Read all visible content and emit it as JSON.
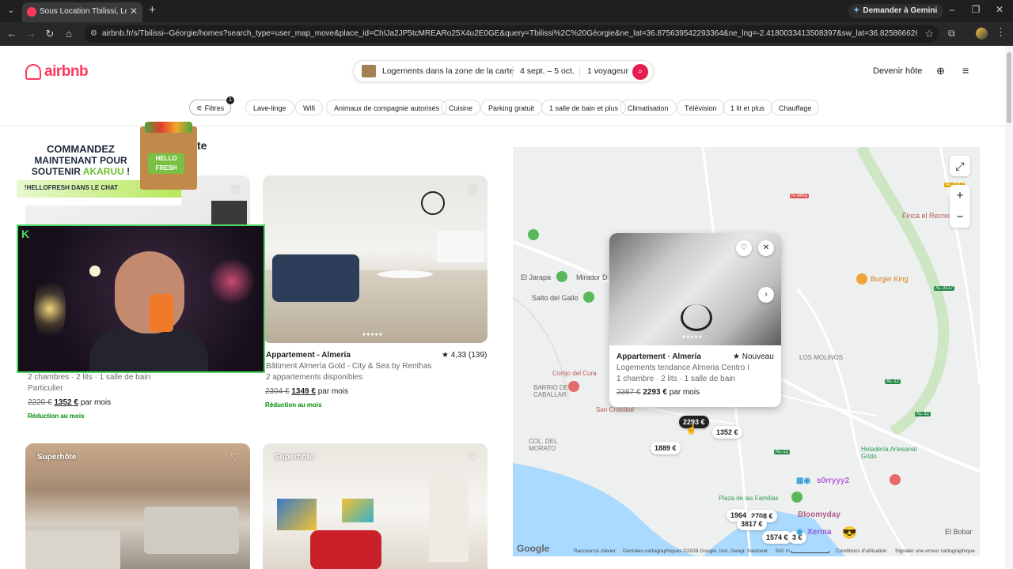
{
  "browser": {
    "tab_title": "Sous Location Tbilissi, Location",
    "gemini_label": "Demander à Gemini",
    "url": "airbnb.fr/s/Tbilissi--Géorgie/homes?search_type=user_map_move&place_id=ChIJa2JP5tcMREARo25X4u2E0GE&query=Tbilissi%2C%20Géorgie&ne_lat=36.875639542293364&ne_lng=-2.4180033413508397&sw_lat=36.82586662628848&sw_lng=-2..."
  },
  "header": {
    "logo": "airbnb",
    "search_location": "Logements dans la zone de la carte",
    "search_dates": "4 sept. – 5 oct.",
    "search_guests": "1 voyageur",
    "host_link": "Devenir hôte"
  },
  "filters": {
    "filter_label": "Filtres",
    "filter_count": "1",
    "chips": [
      "Lave-linge",
      "Wifi",
      "Animaux de compagnie autorisés",
      "Cuisine",
      "Parking gratuit",
      "1 salle de bain et plus",
      "Climatisation",
      "Télévision",
      "1 lit et plus",
      "Chauffage"
    ]
  },
  "listings": {
    "title_fragment": "carte",
    "card1": {
      "details": "2 chambres · 2 lits · 1 salle de bain",
      "host_type": "Particulier",
      "price_old": "2220 €",
      "price_new": "1352 €",
      "price_suffix": "par mois",
      "discount": "Réduction au mois"
    },
    "card2": {
      "title": "Appartement - Almería",
      "rating": "★ 4,33 (139)",
      "subtitle": "Bâtiment Almería Gold - City & Sea by Renthas",
      "availability": "2 appartements disponibles",
      "price_old": "2304 €",
      "price_new": "1349 €",
      "price_suffix": "par mois",
      "discount": "Réduction au mois"
    },
    "card3": {
      "badge": "Superhôte"
    },
    "card4": {
      "badge": "Superhôte"
    }
  },
  "promo": {
    "line1": "COMMANDEZ",
    "line2": "MAINTENANT POUR",
    "line3_prefix": "SOUTENIR ",
    "line3_accent": "AKARUU",
    "line3_suffix": " !",
    "bar_text": "!HELLOFRESH DANS LE CHAT",
    "box_label": "HELLO FRESH"
  },
  "webcam": {
    "logo_letter": "K"
  },
  "map": {
    "places": [
      "El Jarapa",
      "Mirador D",
      "Salto del Gallo",
      "Burger King",
      "Finca el Recreo",
      "BARRIO DEL CABALLAR",
      "Cortijo del Cura",
      "San Cristóbal",
      "COL. DEL MORATO",
      "LOS MOLINOS",
      "Heladería Artesanal Grido",
      "Plaza de las Familias",
      "Bloomyday",
      "El Bobar"
    ],
    "road_tags": [
      "AL-3117",
      "N-340a",
      "AL-3117",
      "AL-12",
      "AL-12",
      "AL-12"
    ],
    "popup": {
      "title": "Appartement · Almería",
      "rating": "★ Nouveau",
      "subtitle": "Logements tendance Almeria Centro I",
      "details": "1 chambre · 2 lits · 1 salle de bain",
      "price_old": "2367 €",
      "price_new": "2293 €",
      "price_suffix": "par mois"
    },
    "pills": {
      "selected": "2293 €",
      "p1": "1352 €",
      "p2": "1889 €",
      "p3": "1964",
      "p4": "2708 €",
      "p5": "3817 €",
      "p6": "1574 €",
      "p7": "3 €"
    },
    "footer": {
      "google": "Google",
      "shortcuts": "Raccourcis clavier",
      "copyright": "Données cartographiques ©2026 Google, Inst. Geogr. Nacional",
      "scale": "500 m",
      "terms": "Conditions d'utilisation",
      "report": "Signaler une erreur cartographique"
    },
    "chat_overlay": {
      "user1": "s0rryyy2",
      "user2": "Xerma"
    }
  }
}
